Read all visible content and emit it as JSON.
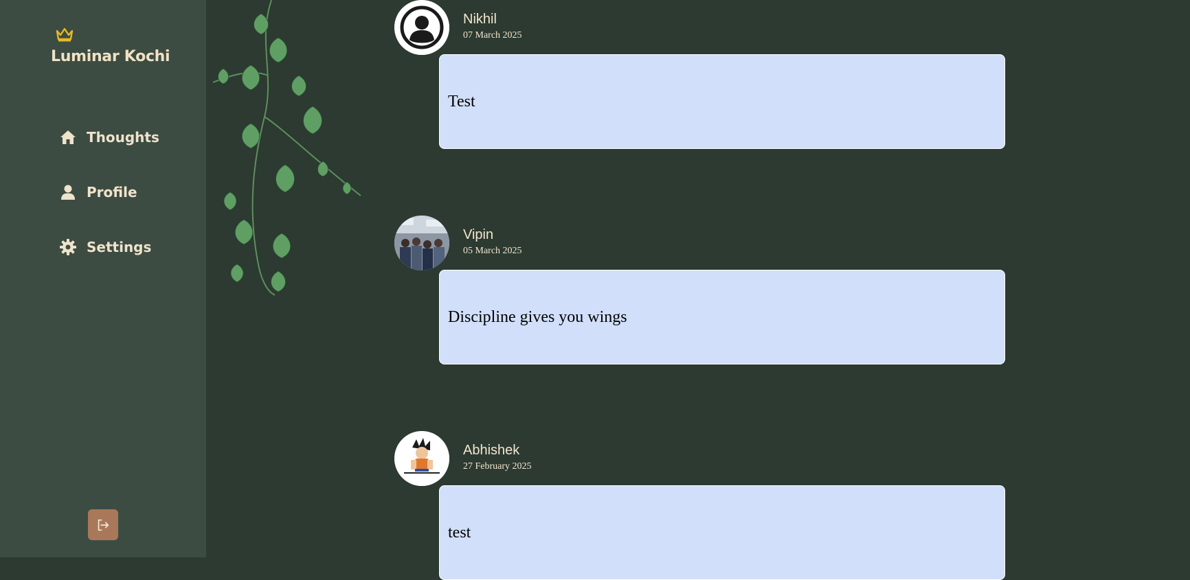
{
  "app": {
    "name": "Luminar Kochi"
  },
  "nav": [
    {
      "label": "Thoughts",
      "icon": "home-icon"
    },
    {
      "label": "Profile",
      "icon": "user-icon"
    },
    {
      "label": "Settings",
      "icon": "gear-icon"
    }
  ],
  "logout": {
    "icon": "logout-icon"
  },
  "colors": {
    "sidebar": "#3d4c42",
    "background": "#2c3a31",
    "accent": "#a9785a",
    "crown": "#e8b923",
    "bubble": "#d2dffa",
    "text_light": "#f0e2c4"
  },
  "posts": [
    {
      "user": "Nikhil",
      "date": "07 March 2025",
      "text": "Test",
      "avatar": "default-avatar"
    },
    {
      "user": "Vipin",
      "date": "05 March 2025",
      "text": "Discipline gives you wings",
      "avatar": "group-photo-avatar"
    },
    {
      "user": "Abhishek",
      "date": "27 February 2025",
      "text": "test",
      "avatar": "cartoon-avatar"
    }
  ]
}
